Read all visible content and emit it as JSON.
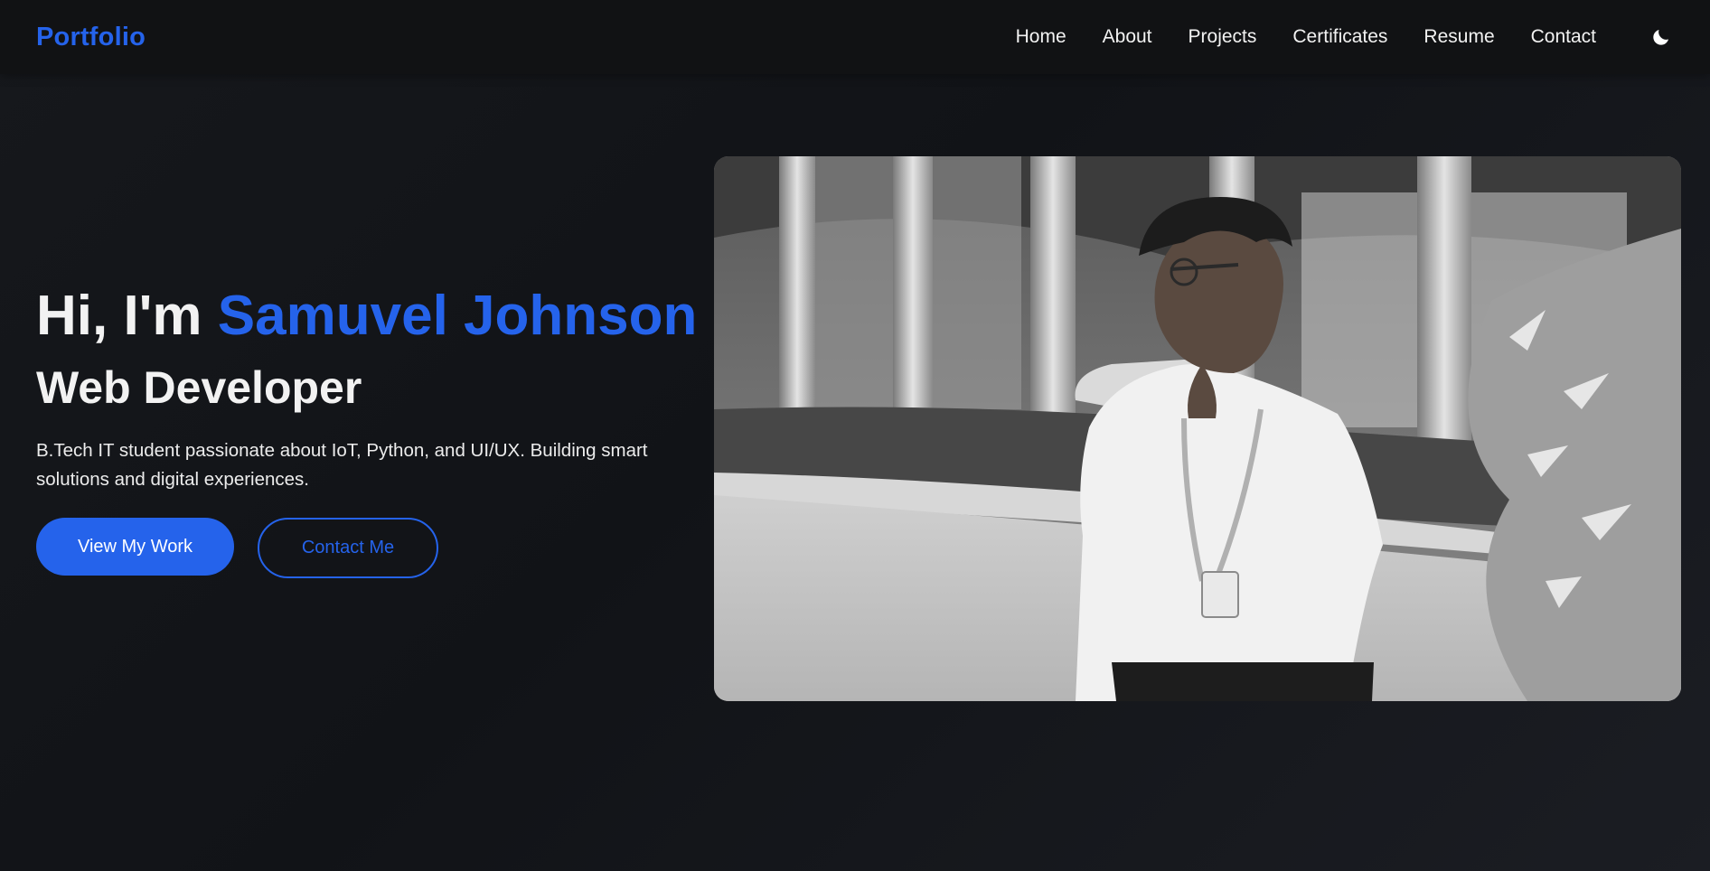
{
  "nav": {
    "logo": "Portfolio",
    "links": [
      "Home",
      "About",
      "Projects",
      "Certificates",
      "Resume",
      "Contact"
    ],
    "theme_icon": "moon-icon"
  },
  "hero": {
    "greeting_prefix": "Hi, I'm ",
    "name": "Samuvel Johnson",
    "role": "Web Developer",
    "bio": "B.Tech IT student passionate about IoT, Python, and UI/UX. Building smart solutions and digital experiences.",
    "primary_button": "View My Work",
    "secondary_button": "Contact Me"
  },
  "colors": {
    "accent": "#2563eb",
    "background": "#15171b",
    "navbar": "#111214",
    "text": "#f2f2f2"
  }
}
